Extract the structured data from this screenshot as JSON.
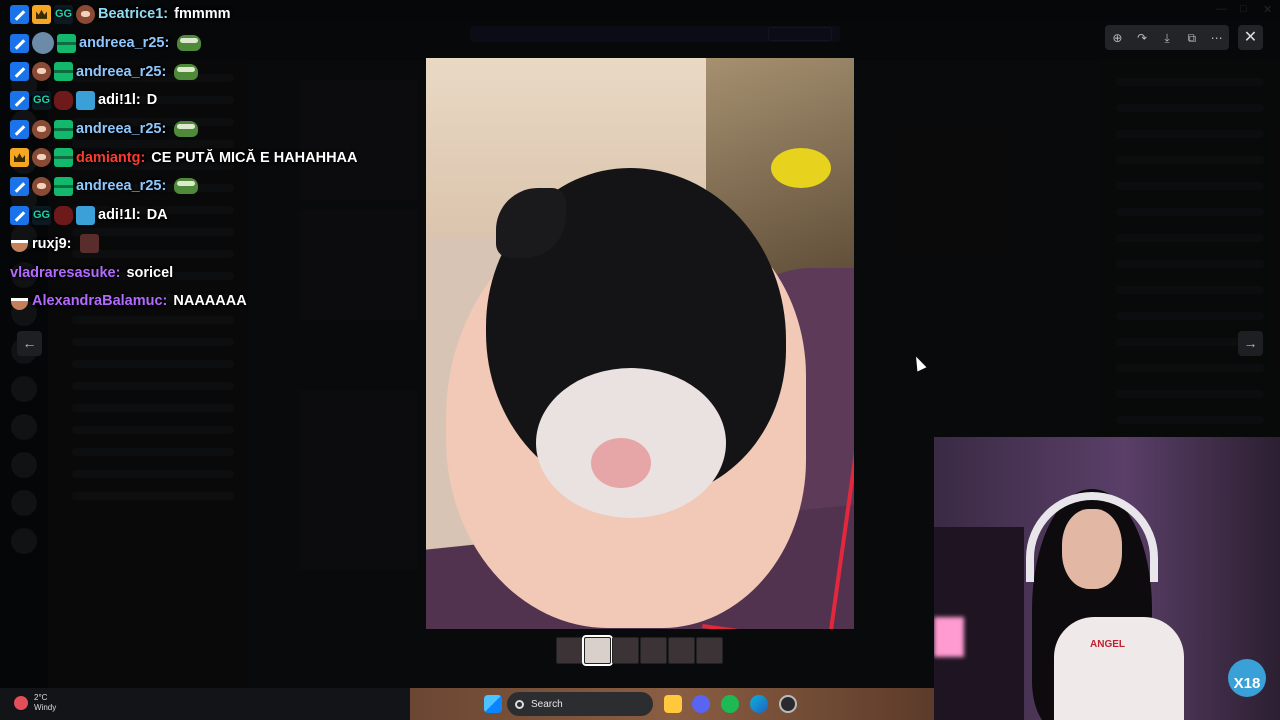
{
  "chat": [
    {
      "badges": [
        "hammer",
        "crown",
        "gg",
        "cat"
      ],
      "user": "Beatrice1:",
      "color": "#8fdcf5",
      "text": "fmmmm"
    },
    {
      "badges": [
        "hammer",
        "avatar",
        "gift"
      ],
      "user": "andreea_r25:",
      "color": "#8fc8ff",
      "text": "",
      "emote": "pepe"
    },
    {
      "badges": [
        "hammer",
        "cat",
        "gift"
      ],
      "user": "andreea_r25:",
      "color": "#8fc8ff",
      "text": "",
      "emote": "pepe"
    },
    {
      "badges": [
        "hammer",
        "gg",
        "wolf",
        "heart"
      ],
      "user": "adi!1l:",
      "color": "#ffffff",
      "text": "D"
    },
    {
      "badges": [
        "hammer",
        "cat",
        "gift"
      ],
      "user": "andreea_r25:",
      "color": "#8fc8ff",
      "text": "",
      "emote": "pepe"
    },
    {
      "badges": [
        "crown",
        "cat",
        "gift"
      ],
      "user": "damiantg:",
      "color": "#ff3b30",
      "text": "CE PUTĂ MICĂ E HAHAHHAA"
    },
    {
      "badges": [
        "hammer",
        "cat",
        "gift"
      ],
      "user": "andreea_r25:",
      "color": "#8fc8ff",
      "text": "",
      "emote": "pepe"
    },
    {
      "badges": [
        "hammer",
        "gg",
        "wolf",
        "heart"
      ],
      "user": "adi!1l:",
      "color": "#ffffff",
      "text": "DA"
    },
    {
      "badges": [
        "coffee"
      ],
      "user": "ruxj9:",
      "color": "#ffffff",
      "text": "",
      "emote": "ghost"
    },
    {
      "badges": [],
      "user": "vladraresasuke:",
      "color": "#b36bff",
      "text": "soricel"
    },
    {
      "badges": [
        "coffee"
      ],
      "user": "AlexandraBalamuc:",
      "color": "#b36bff",
      "text": "NAAAAAA"
    }
  ],
  "lightbox": {
    "toolbar": [
      "zoom-icon",
      "forward-icon",
      "download-icon",
      "open-external-icon",
      "more-icon"
    ],
    "thumbnail_count": 6,
    "active_thumbnail": 2
  },
  "webcam": {
    "shirt_text": "ANGEL",
    "logo_text": "X18"
  },
  "taskbar": {
    "temperature": "2°C",
    "condition": "Windy",
    "search_label": "Search"
  },
  "colors": {
    "accent": "#5865f2",
    "red_cord": "#e3273c"
  }
}
